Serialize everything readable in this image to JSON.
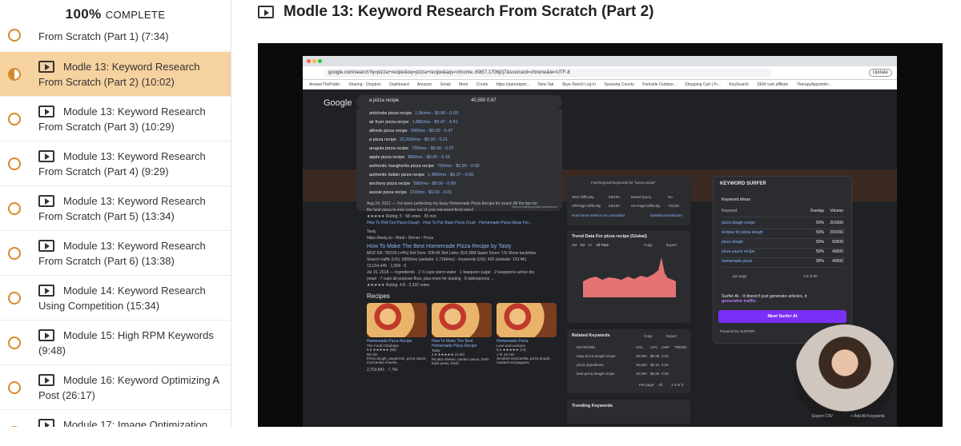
{
  "sidebar": {
    "progress": {
      "percent_label": "100%",
      "complete_label": "COMPLETE"
    },
    "lessons": [
      {
        "label": "From Scratch (Part 1) (7:34)",
        "state": "complete"
      },
      {
        "label": "Modle 13: Keyword Research From Scratch (Part 2) (10:02)",
        "state": "in-progress"
      },
      {
        "label": "Module 13: Keyword Research From Scratch (Part 3) (10:29)",
        "state": "incomplete"
      },
      {
        "label": "Module 13: Keyword Research From Scratch (Part 4) (9:29)",
        "state": "incomplete"
      },
      {
        "label": "Module 13: Keyword Research From Scratch (Part 5) (13:34)",
        "state": "incomplete"
      },
      {
        "label": "Module 13: Keyword Research From Scratch (Part 6) (13:38)",
        "state": "incomplete"
      },
      {
        "label": "Module 14: Keyword Research Using Competition (15:34)",
        "state": "incomplete"
      },
      {
        "label": "Module 15: High RPM Keywords (9:48)",
        "state": "incomplete"
      },
      {
        "label": "Module 16: Keyword Optimizing A Post (26:17)",
        "state": "incomplete"
      },
      {
        "label": "Module 17: Image Optimization (14:18)",
        "state": "incomplete"
      }
    ]
  },
  "main": {
    "title": "Modle 13: Keyword Research From Scratch (Part 2)"
  },
  "video": {
    "url": "google.com/search?q=pizza+recipe&oq=pizza+recipe&aqs=chrome..69i57.1706j0j7&sourceid=chrome&ie=UTF-8",
    "update_label": "Update",
    "bookmarks": [
      "AnswerThePublic",
      "Sharing - Dropbox",
      "Dashboard",
      "Amazon",
      "Gmail",
      "Meet",
      "Courts",
      "https://parentport...",
      "New Tab",
      "Skye Ranch Log In",
      "Sarasota County",
      "Parkside Outdoor...",
      "Shopping Cart | Fr...",
      "KeySearch",
      "SEM rush affiliate",
      "TherapyAppointm..."
    ],
    "google": {
      "logo": "Google",
      "query": "a pizza recipe",
      "metrics": "40,550  0.87",
      "suggestions": [
        {
          "text": "artichoke pizza recipe",
          "stat": "1,9k/mo - $0.80 - 0.03"
        },
        {
          "text": "air fryer pizza recipe",
          "stat": "1,880/mo - $0.47 - 0.41"
        },
        {
          "text": "alfredo pizza recipe",
          "stat": "590/mo - $0.00 - 0.47"
        },
        {
          "text": "a pizza recipe",
          "stat": "22,200/mo - $0.00 - 0.21"
        },
        {
          "text": "arugula pizza recipe",
          "stat": "720/mo - $0.00 - 0.07"
        },
        {
          "text": "apple pizza recipe",
          "stat": "880/mo - $0.00 - 0.18"
        },
        {
          "text": "authentic margherita pizza recipe",
          "stat": "720/mo - $0.89 - 0.00"
        },
        {
          "text": "authentic italian pizza recipe",
          "stat": "1,480/mo - $0.27 - 0.00"
        },
        {
          "text": "anchovy pizza recipe",
          "stat": "590/mo - $0.00 - 0.00"
        },
        {
          "text": "aussie pizza recipe",
          "stat": "210/mo - $0.00 - 0.01"
        }
      ],
      "report_label": "Report inappropriate predictions",
      "result_lines": [
        "Aug 24, 2021 — I've been perfecting my Easy Homemade Pizza Recipe for years! All the tips for",
        "the best pizza to ever come out of your not-wood-fired oven!",
        "★★★★★ Rating: 5 · 58 votes · 55 min"
      ],
      "result_links": "How To Roll Out Pizza Dough · How To Par Bake Pizza Crust · Homemade Pizza Ideas For...",
      "tasty_site": "Tasty",
      "tasty_url": "https://tasty.co › Meal › Dinner › Pizza",
      "tasty_title": "How To Make The Best Homemade Pizza Recipe by Tasty",
      "tasty_lines": [
        "MOZ DA: 78/100 (+4%)  Ref Dom: 208.4K  Ref Links: 819.36M  Spam Score: 1%  Show backlinks",
        "Search traffic (US): 6850/mo (website: 1.71M/mo) - Keywords (US): 420 (website: 153.4K)",
        "13,014,445 · 1,058 · 0",
        "Jul 15, 2018 — Ingredients · 2 ½ cups warm water · 1 teaspoon sugar · 2 teaspoons active dry",
        "yeast · 7 cups all-purpose flour, plus more for dusting · 6 tablespoons ...",
        "★★★★★ Rating: 4.8 · 3,332 votes"
      ],
      "recipes_heading": "Recipes",
      "recipes": [
        {
          "title": "Homemade Pizza Recipe",
          "source": "The Food Charlatan",
          "rating": "5.0 ★★★★★ (58)",
          "time": "55 min",
          "desc": "Pizza dough, pepperoni, pizza sauce, mozzarella cheese,"
        },
        {
          "title": "How To Make The Best Homemade Pizza Recipe",
          "source": "Tasty",
          "rating": "4.8 ★★★★★ (3.3K)",
          "time": "",
          "desc": "Ricotta cheese, tomato sauce, fresh basil pesto, fresh"
        },
        {
          "title": "Homemade Pizza",
          "source": "Love and Lemons",
          "rating": "5.0 ★★★★★ (14)",
          "time": "1 hr 20 min",
          "desc": "Smoked mozzarella, pizza dough, roasted red peppers,"
        }
      ],
      "recipes_footer": "2,703,841 · 7,741"
    },
    "seo_panel": {
      "placeholder": "Find long-tail keywords for \"pizza recipe\"",
      "seo_difficulty": "SEO Difficulty",
      "seo_difficulty_value": "66/100",
      "brand_query": "Brand Query",
      "brand_query_value": "No",
      "offpage": "Off-Page Difficulty",
      "offpage_value": "63/100",
      "onpage": "On-Page Difficulty",
      "onpage_value": "72/100",
      "how_calc": "How these metrics are calculated",
      "detailed": "Detailed breakdown"
    },
    "trend": {
      "title": "Trend Data For pizza recipe (Global)",
      "ranges": [
        "1M",
        "3M",
        "1Y",
        "All Time"
      ],
      "copy": "Copy",
      "export": "Export",
      "y_ticks": [
        "450,000",
        "400,000",
        "350,000",
        "300,000",
        "250,000",
        "200,000",
        "150,000",
        "100,000",
        "50,000"
      ],
      "x_ticks": [
        "2005",
        "2008",
        "2013",
        "2016",
        "2021"
      ]
    },
    "related": {
      "title": "Related Keywords",
      "copy": "Copy",
      "export": "Export",
      "headers": [
        "KEYWORD",
        "VOL",
        "CPC",
        "CMP",
        "TREND"
      ],
      "rows": [
        {
          "kw": "easy pizza dough recipe",
          "vol": "40,500",
          "cpc": "$0.38",
          "cmp": "0.05"
        },
        {
          "kw": "pizza ingredients",
          "vol": "40,500",
          "cpc": "$0.10",
          "cmp": "0.04"
        },
        {
          "kw": "best pizza dough recipe",
          "vol": "40,500",
          "cpc": "$0.26",
          "cmp": "0.05"
        }
      ],
      "per_page": "Per page:",
      "per_page_value": "All",
      "page_of": "1-3 of 3"
    },
    "trending": "Trending Keywords",
    "surfer": {
      "title": "KEYWORD SURFER",
      "ideas": "Keyword ideas",
      "headers": [
        "Keyword",
        "Overlap",
        "Volume"
      ],
      "rows": [
        {
          "kw": "pizza dough recipe",
          "overlap": "50%",
          "volume": "201000"
        },
        {
          "kw": "recipes for pizza dough",
          "overlap": "50%",
          "volume": "201000"
        },
        {
          "kw": "pizza dough",
          "overlap": "50%",
          "volume": "60500"
        },
        {
          "kw": "pizza sauce recipe",
          "overlap": "50%",
          "volume": "49500"
        },
        {
          "kw": "homemade pizza",
          "overlap": "95%",
          "volume": "40500"
        }
      ],
      "per_page": "per page",
      "page_of": "1-5 of 80",
      "ai_text": "Surfer AI - It doesn't just generate articles, it",
      "ai_highlight": "generates traffic.",
      "meet_button": "Meet Surfer AI",
      "powered": "Powered by SURFER"
    },
    "export_csv": "Export CSV",
    "add_all": "+ Add All Keywords"
  },
  "colors": {
    "accent": "#d8892a",
    "active_row": "#f6d2a0",
    "surfer_button": "#7b2ff7"
  }
}
